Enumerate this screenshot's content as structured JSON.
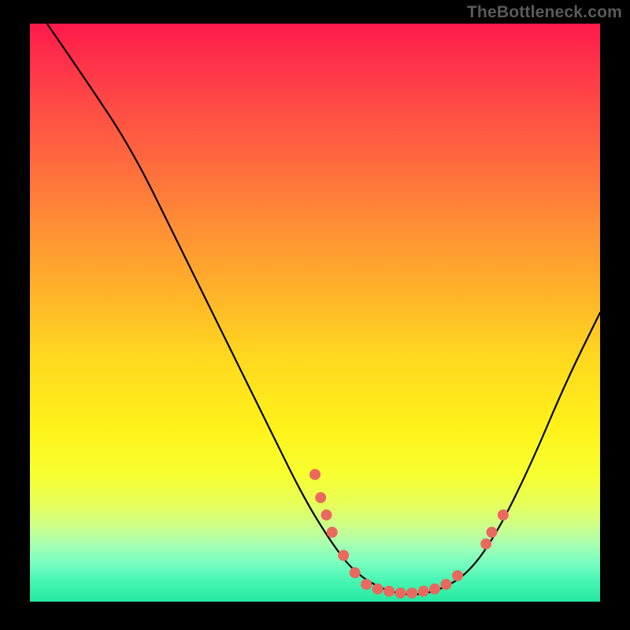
{
  "watermark": "TheBottleneck.com",
  "chart_data": {
    "type": "line",
    "title": "",
    "xlabel": "",
    "ylabel": "",
    "xlim": [
      0,
      100
    ],
    "ylim": [
      0,
      100
    ],
    "curve": [
      {
        "x": 3,
        "y": 100
      },
      {
        "x": 10,
        "y": 90
      },
      {
        "x": 18,
        "y": 78
      },
      {
        "x": 26,
        "y": 62
      },
      {
        "x": 34,
        "y": 46
      },
      {
        "x": 42,
        "y": 30
      },
      {
        "x": 48,
        "y": 18
      },
      {
        "x": 53,
        "y": 10
      },
      {
        "x": 57,
        "y": 5
      },
      {
        "x": 62,
        "y": 2
      },
      {
        "x": 67,
        "y": 1
      },
      {
        "x": 72,
        "y": 2
      },
      {
        "x": 77,
        "y": 5
      },
      {
        "x": 82,
        "y": 12
      },
      {
        "x": 88,
        "y": 24
      },
      {
        "x": 94,
        "y": 38
      },
      {
        "x": 100,
        "y": 50
      }
    ],
    "points": [
      {
        "x": 50,
        "y": 22
      },
      {
        "x": 51,
        "y": 18
      },
      {
        "x": 52,
        "y": 15
      },
      {
        "x": 53,
        "y": 12
      },
      {
        "x": 55,
        "y": 8
      },
      {
        "x": 57,
        "y": 5
      },
      {
        "x": 59,
        "y": 3
      },
      {
        "x": 61,
        "y": 2.2
      },
      {
        "x": 63,
        "y": 1.8
      },
      {
        "x": 65,
        "y": 1.5
      },
      {
        "x": 67,
        "y": 1.5
      },
      {
        "x": 69,
        "y": 1.8
      },
      {
        "x": 71,
        "y": 2.2
      },
      {
        "x": 73,
        "y": 3
      },
      {
        "x": 75,
        "y": 4.5
      },
      {
        "x": 80,
        "y": 10
      },
      {
        "x": 81,
        "y": 12
      },
      {
        "x": 83,
        "y": 15
      }
    ],
    "point_radius": 7
  }
}
